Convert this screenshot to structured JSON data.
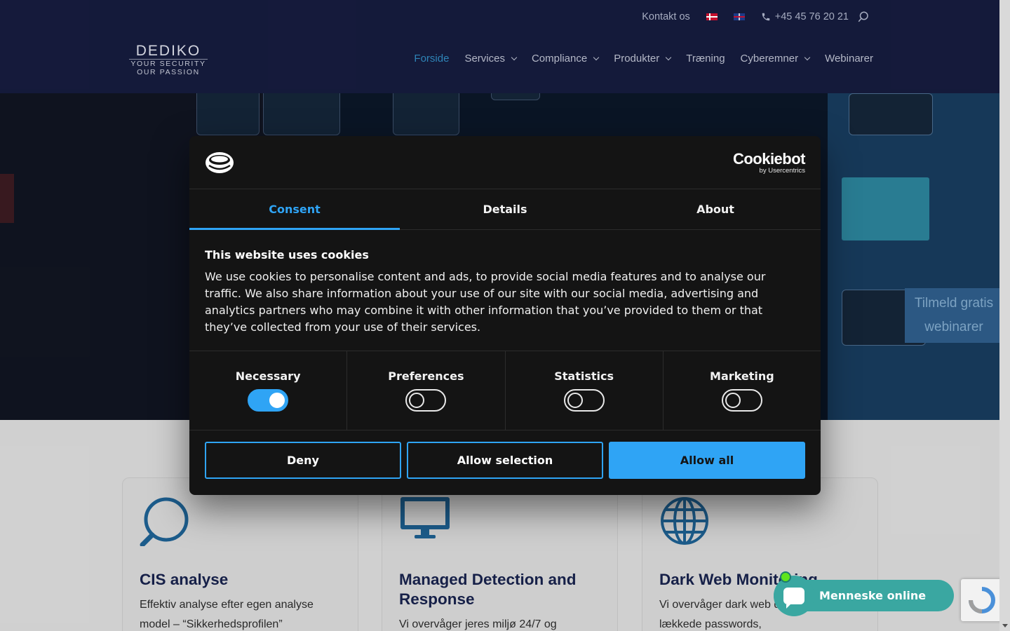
{
  "topbar": {
    "contact": "Kontakt os",
    "phone": "+45 45 76 20 21"
  },
  "logo": {
    "name": "DEDIKO",
    "line1": "YOUR SECURITY",
    "line2": "OUR PASSION"
  },
  "nav": {
    "items": [
      {
        "label": "Forside",
        "active": true
      },
      {
        "label": "Services",
        "dropdown": true
      },
      {
        "label": "Compliance",
        "dropdown": true
      },
      {
        "label": "Produkter",
        "dropdown": true
      },
      {
        "label": "Træning"
      },
      {
        "label": "Cyberemner",
        "dropdown": true
      },
      {
        "label": "Webinarer"
      }
    ]
  },
  "webinar_tab": {
    "line1": "Tilmeld gratis",
    "line2": "webinarer"
  },
  "cookie": {
    "brand": "Cookiebot",
    "brand_sub": "by Usercentrics",
    "tabs": [
      "Consent",
      "Details",
      "About"
    ],
    "title": "This website uses cookies",
    "text": "We use cookies to personalise content and ads, to provide social media features and to analyse our traffic. We also share information about your use of our site with our social media, advertising and analytics partners who may combine it with other information that you’ve provided to them or that they’ve collected from your use of their services.",
    "toggles": [
      {
        "label": "Necessary",
        "on": true
      },
      {
        "label": "Preferences",
        "on": false
      },
      {
        "label": "Statistics",
        "on": false
      },
      {
        "label": "Marketing",
        "on": false
      }
    ],
    "buttons": {
      "deny": "Deny",
      "allow_selection": "Allow selection",
      "allow_all": "Allow all"
    },
    "accent": "#2fa4f5"
  },
  "cards": [
    {
      "title": "CIS analyse",
      "text": "Effektiv analyse efter egen analyse model – “Sikkerhedsprofilen”",
      "icon": "magnifier-icon"
    },
    {
      "title": "Managed Detection and Response",
      "text": "Vi overvåger jeres miljø 24/7 og",
      "icon": "monitor-icon"
    },
    {
      "title": "Dark Web Monitoring",
      "text": "Vi overvåger dark web databaser for lækkede passwords,",
      "icon": "globe-icon"
    }
  ],
  "chat": {
    "label": "Menneske online",
    "color": "#3aa7a1"
  }
}
